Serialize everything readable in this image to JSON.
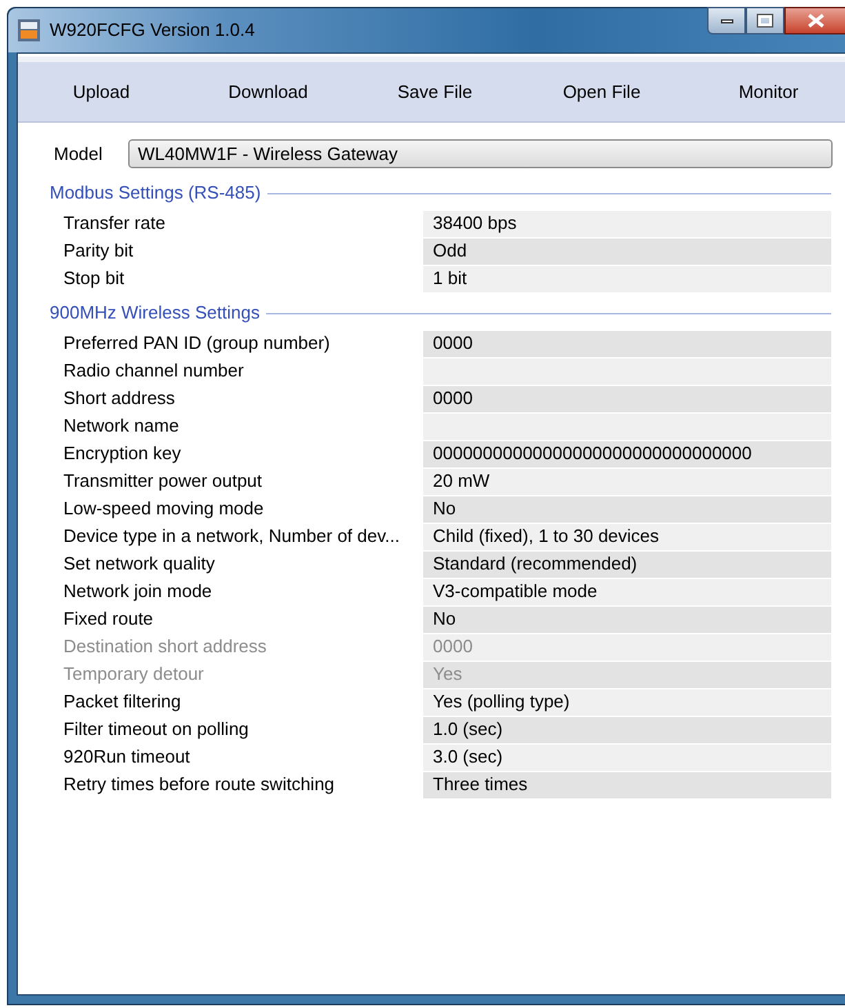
{
  "window": {
    "title": "W920FCFG Version 1.0.4"
  },
  "toolbar": [
    "Upload",
    "Download",
    "Save File",
    "Open File",
    "Monitor"
  ],
  "model": {
    "label": "Model",
    "value": "WL40MW1F - Wireless Gateway"
  },
  "sections": [
    {
      "title": "Modbus Settings (RS-485)",
      "rows": [
        {
          "label": "Transfer rate",
          "value": "38400 bps",
          "disabled": false
        },
        {
          "label": "Parity bit",
          "value": "Odd",
          "disabled": false
        },
        {
          "label": "Stop bit",
          "value": "1 bit",
          "disabled": false
        }
      ]
    },
    {
      "title": "900MHz Wireless Settings",
      "rows": [
        {
          "label": "Preferred PAN ID (group number)",
          "value": "0000",
          "disabled": false
        },
        {
          "label": "Radio channel number",
          "disabled": false
        },
        {
          "label": "Short address",
          "value": "0000",
          "disabled": false
        },
        {
          "label": "Network name",
          "disabled": false
        },
        {
          "label": "Encryption key",
          "value": "00000000000000000000000000000000",
          "disabled": false
        },
        {
          "label": "Transmitter power output",
          "value": "20 mW",
          "disabled": false
        },
        {
          "label": "Low-speed moving mode",
          "value": "No",
          "disabled": false
        },
        {
          "label": "Device type in a network, Number of dev...",
          "value": "Child (fixed), 1 to 30 devices",
          "disabled": false
        },
        {
          "label": "Set network quality",
          "value": "Standard (recommended)",
          "disabled": false
        },
        {
          "label": "Network join mode",
          "value": "V3-compatible mode",
          "disabled": false
        },
        {
          "label": "Fixed route",
          "value": "No",
          "disabled": false
        },
        {
          "label": "Destination short address",
          "value": "0000",
          "disabled": true
        },
        {
          "label": "Temporary detour",
          "value": "Yes",
          "disabled": true
        },
        {
          "label": "Packet filtering",
          "value": "Yes (polling type)",
          "disabled": false
        },
        {
          "label": "Filter timeout on polling",
          "value": "1.0 (sec)",
          "disabled": false
        },
        {
          "label": "920Run timeout",
          "value": "3.0 (sec)",
          "disabled": false
        },
        {
          "label": "Retry times before route switching",
          "value": "Three times",
          "disabled": false
        }
      ]
    }
  ]
}
